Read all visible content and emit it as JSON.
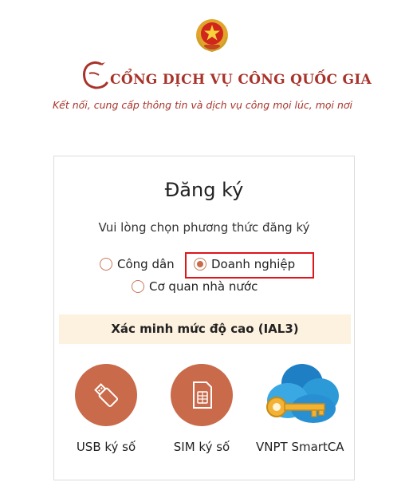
{
  "header": {
    "brand_title": "CỔNG DỊCH VỤ CÔNG QUỐC GIA",
    "tagline": "Kết nối, cung cấp thông tin và dịch vụ công mọi lúc, mọi nơi",
    "emblem_icon": "national-emblem-icon",
    "logo_icon": "crane-bird-logo-icon"
  },
  "card": {
    "title": "Đăng ký",
    "subtitle": "Vui lòng chọn phương thức đăng ký",
    "options": [
      {
        "label": "Công dân",
        "selected": false
      },
      {
        "label": "Doanh nghiệp",
        "selected": true
      },
      {
        "label": "Cơ quan nhà nước",
        "selected": false
      }
    ],
    "banner": "Xác minh mức độ cao (IAL3)",
    "methods": [
      {
        "label": "USB ký số",
        "icon": "usb-token-icon"
      },
      {
        "label": "SIM ký số",
        "icon": "sim-card-icon"
      },
      {
        "label": "VNPT SmartCA",
        "icon": "cloud-key-icon"
      }
    ]
  },
  "colors": {
    "brand_red": "#a8332a",
    "accent": "#c96a4a",
    "banner_bg": "#fdf1df",
    "highlight": "#e0141b"
  }
}
